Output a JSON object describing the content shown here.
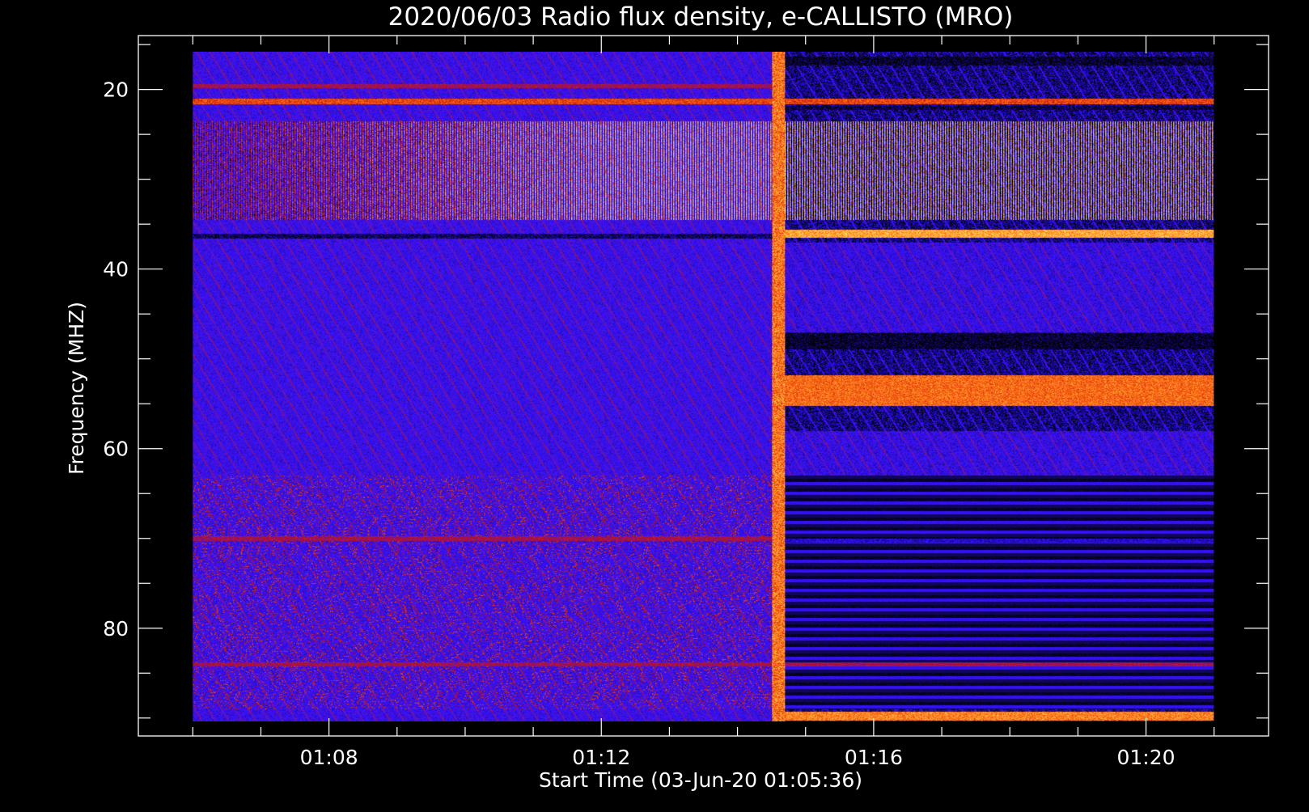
{
  "chart_data": {
    "type": "heatmap",
    "title": "2020/06/03  Radio flux density, e-CALLISTO (MRO)",
    "xlabel": "Start Time (03-Jun-20 01:05:36)",
    "ylabel": "Frequency (MHZ)",
    "x_axis": {
      "unit": "minutes after 01:00",
      "range": [
        5.2,
        21.8
      ],
      "data_range": [
        6.0,
        21.0
      ],
      "major_ticks": [
        {
          "value": 8,
          "label": "01:08"
        },
        {
          "value": 12,
          "label": "01:12"
        },
        {
          "value": 16,
          "label": "01:16"
        },
        {
          "value": 20,
          "label": "01:20"
        }
      ],
      "minor_tick_step": 1
    },
    "y_axis": {
      "unit": "MHz",
      "inverted": true,
      "range": [
        14.0,
        92.0
      ],
      "data_range": [
        15.8,
        90.4
      ],
      "major_ticks": [
        {
          "value": 20,
          "label": "20"
        },
        {
          "value": 40,
          "label": "40"
        },
        {
          "value": 60,
          "label": "60"
        },
        {
          "value": 80,
          "label": "80"
        }
      ],
      "minor_tick_step": 5
    },
    "colormap": [
      "#000000",
      "#2a10ff",
      "#5a14d0",
      "#c01010",
      "#ff6a10",
      "#ffe060",
      "#ffffff"
    ],
    "background_level": 0.22,
    "event": {
      "label": "",
      "onset_time": 14.6,
      "description_levels": {
        "pre_event": 0.2,
        "post_event_background": 0.08
      }
    },
    "bands": [
      {
        "freq": 19.6,
        "width": 0.5,
        "t0": 6.0,
        "t1": 14.6,
        "level": 0.45
      },
      {
        "freq": 21.3,
        "width": 0.6,
        "t0": 6.0,
        "t1": 21.0,
        "level": 0.6
      },
      {
        "freq": 22.0,
        "width": 0.5,
        "t0": 14.6,
        "t1": 21.0,
        "level": 0.04
      },
      {
        "freq": 16.8,
        "width": 1.0,
        "t0": 14.6,
        "t1": 21.0,
        "level": 0.02
      },
      {
        "freq": 36.0,
        "width": 0.9,
        "t0": 14.6,
        "t1": 21.0,
        "level": 0.75
      },
      {
        "freq": 36.3,
        "width": 0.5,
        "t0": 6.0,
        "t1": 14.6,
        "level": 0.06
      },
      {
        "freq": 48.0,
        "width": 1.8,
        "t0": 14.6,
        "t1": 21.0,
        "level": 0.02
      },
      {
        "freq": 53.5,
        "width": 3.5,
        "t0": 14.6,
        "t1": 21.0,
        "level": 0.66
      },
      {
        "freq": 70.0,
        "width": 0.6,
        "t0": 6.0,
        "t1": 14.6,
        "level": 0.45
      },
      {
        "freq": 70.2,
        "width": 0.5,
        "t0": 14.6,
        "t1": 21.0,
        "level": 0.15
      },
      {
        "freq": 84.0,
        "width": 0.5,
        "t0": 6.0,
        "t1": 21.0,
        "level": 0.45
      },
      {
        "freq": 89.8,
        "width": 1.0,
        "t0": 14.6,
        "t1": 21.0,
        "level": 0.7
      }
    ],
    "hatched_region": {
      "freq_min": 23.5,
      "freq_max": 34.5,
      "t0": 6.0,
      "t1": 21.0,
      "level": 0.55
    },
    "speckle_regions": [
      {
        "freq_min": 63.0,
        "freq_max": 89.0,
        "t0": 6.0,
        "t1": 14.5,
        "level": 0.45
      }
    ]
  }
}
